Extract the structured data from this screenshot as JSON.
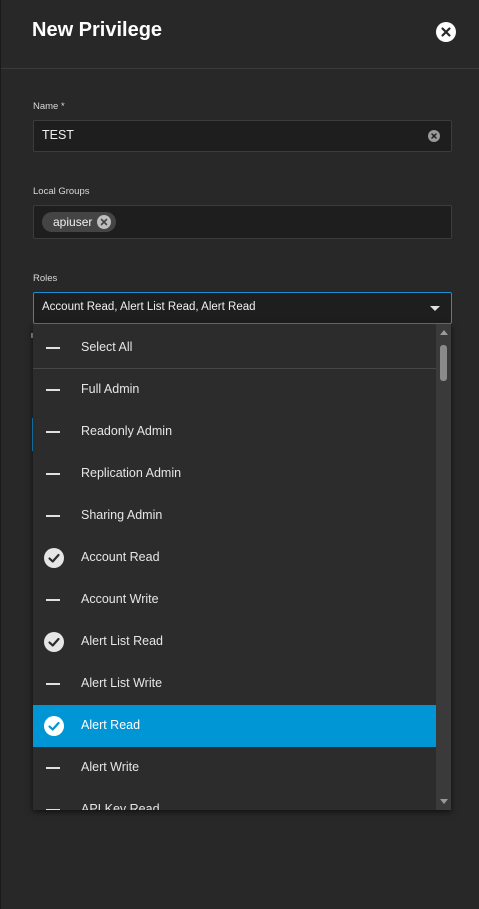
{
  "dialog": {
    "title": "New Privilege"
  },
  "name_field": {
    "label": "Name *",
    "value": "TEST"
  },
  "local_groups": {
    "label": "Local Groups",
    "chips": [
      "apiuser"
    ]
  },
  "roles": {
    "label": "Roles",
    "selected_value": "Account Read, Alert List Read, Alert Read",
    "options": [
      {
        "label": "Select All",
        "state": "unchecked"
      },
      {
        "label": "Full Admin",
        "state": "unchecked"
      },
      {
        "label": "Readonly Admin",
        "state": "unchecked"
      },
      {
        "label": "Replication Admin",
        "state": "unchecked"
      },
      {
        "label": "Sharing Admin",
        "state": "unchecked"
      },
      {
        "label": "Account Read",
        "state": "checked"
      },
      {
        "label": "Account Write",
        "state": "unchecked"
      },
      {
        "label": "Alert List Read",
        "state": "checked"
      },
      {
        "label": "Alert List Write",
        "state": "unchecked"
      },
      {
        "label": "Alert Read",
        "state": "checked",
        "highlighted": true
      },
      {
        "label": "Alert Write",
        "state": "unchecked"
      },
      {
        "label": "API Key Read",
        "state": "unchecked"
      }
    ]
  },
  "icons": {
    "close": "close-icon",
    "clear": "clear-icon",
    "chip_remove": "close-icon",
    "dropdown": "chevron-down-icon",
    "checked": "check-circle-icon",
    "unchecked": "dash-icon"
  },
  "colors": {
    "accent": "#0095d5",
    "panel_bg": "#282828",
    "input_bg": "#1e1e1e"
  }
}
